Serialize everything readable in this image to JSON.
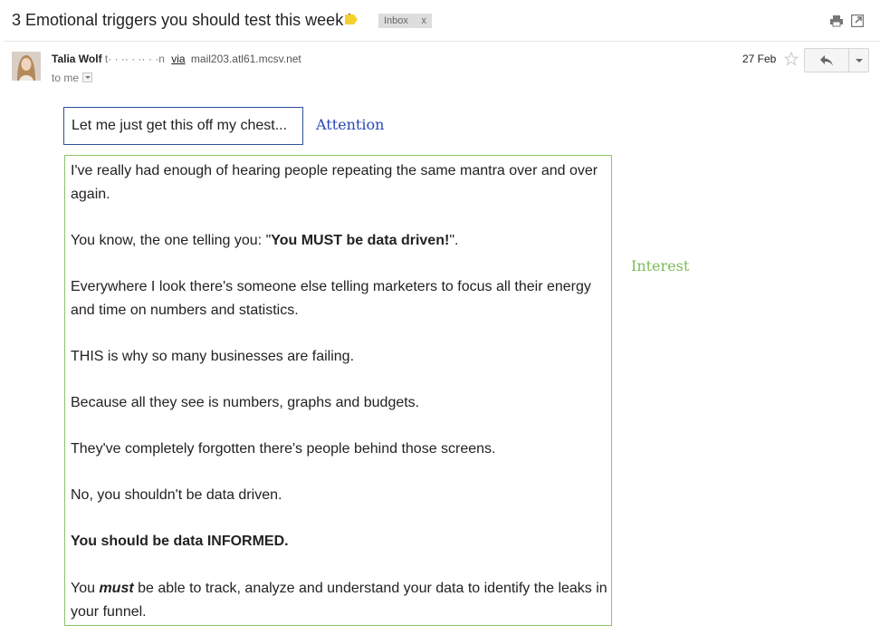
{
  "email": {
    "subject": "3 Emotional triggers you should test this week '",
    "label": "Inbox",
    "label_remove": "x",
    "sender_name": "Talia Wolf",
    "sender_email_partial": "t·  · ·· ·  ··  · ·n",
    "via_label": "via",
    "mailer_domain": "mail203.atl61.mcsv.net",
    "to_label": "to me",
    "date": "27 Feb"
  },
  "toolbar": {
    "print_icon": "print-icon",
    "new_window_icon": "new-window-icon",
    "star_icon": "star-outline",
    "reply_icon": "reply-arrow",
    "more_icon": "chevron-down"
  },
  "annotations": {
    "attention": "Attention",
    "interest": "Interest",
    "attention_color": "#2a49b8",
    "interest_color": "#7cbd56"
  },
  "body": {
    "opening_line": "Let me just get this off my chest...",
    "p1": "I've really had enough of hearing people repeating the same mantra over and over again.",
    "p2_pre": "You know, the one telling you: \"",
    "p2_bold": "You MUST be data driven!",
    "p2_post": "\".",
    "p3": "Everywhere I look there's someone else telling marketers to focus all their energy and time on numbers and statistics.",
    "p4": "THIS is why so many businesses are failing.",
    "p5": "Because all they see is numbers, graphs and budgets.",
    "p6": "They've completely forgotten there's people behind those screens.",
    "p7": "No, you shouldn't be data driven.",
    "p8": "You should be data INFORMED.",
    "p9_pre": "You ",
    "p9_em": "must",
    "p9_post": " be able to track, analyze and understand your data to identify the leaks in your funnel."
  }
}
